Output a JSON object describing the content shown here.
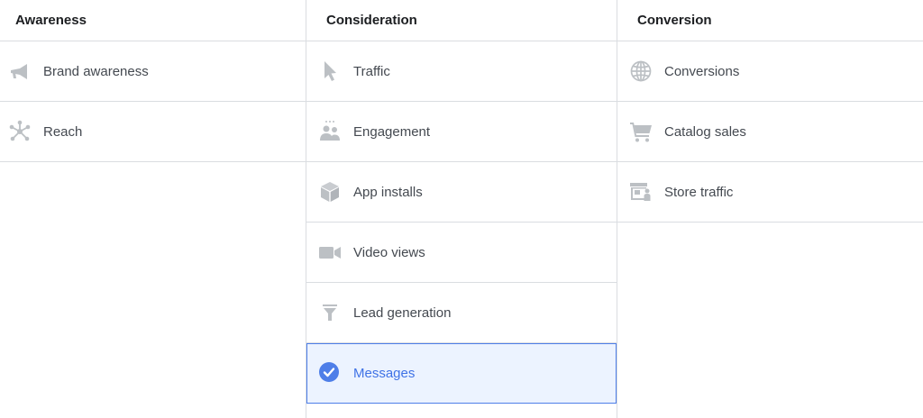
{
  "columns": [
    {
      "title": "Awareness",
      "items": [
        {
          "label": "Brand awareness",
          "icon": "megaphone-icon"
        },
        {
          "label": "Reach",
          "icon": "reach-network-icon"
        }
      ]
    },
    {
      "title": "Consideration",
      "items": [
        {
          "label": "Traffic",
          "icon": "cursor-icon"
        },
        {
          "label": "Engagement",
          "icon": "people-icon"
        },
        {
          "label": "App installs",
          "icon": "box-icon"
        },
        {
          "label": "Video views",
          "icon": "video-camera-icon"
        },
        {
          "label": "Lead generation",
          "icon": "funnel-icon"
        },
        {
          "label": "Messages",
          "icon": "check-circle-icon",
          "selected": true
        }
      ]
    },
    {
      "title": "Conversion",
      "items": [
        {
          "label": "Conversions",
          "icon": "globe-icon"
        },
        {
          "label": "Catalog sales",
          "icon": "shopping-cart-icon"
        },
        {
          "label": "Store traffic",
          "icon": "store-icon"
        }
      ]
    }
  ],
  "colors": {
    "icon": "#bcc0c4",
    "selected_accent": "#4e7ee8",
    "selected_bg": "#ecf3ff",
    "divider": "#dadde1"
  }
}
